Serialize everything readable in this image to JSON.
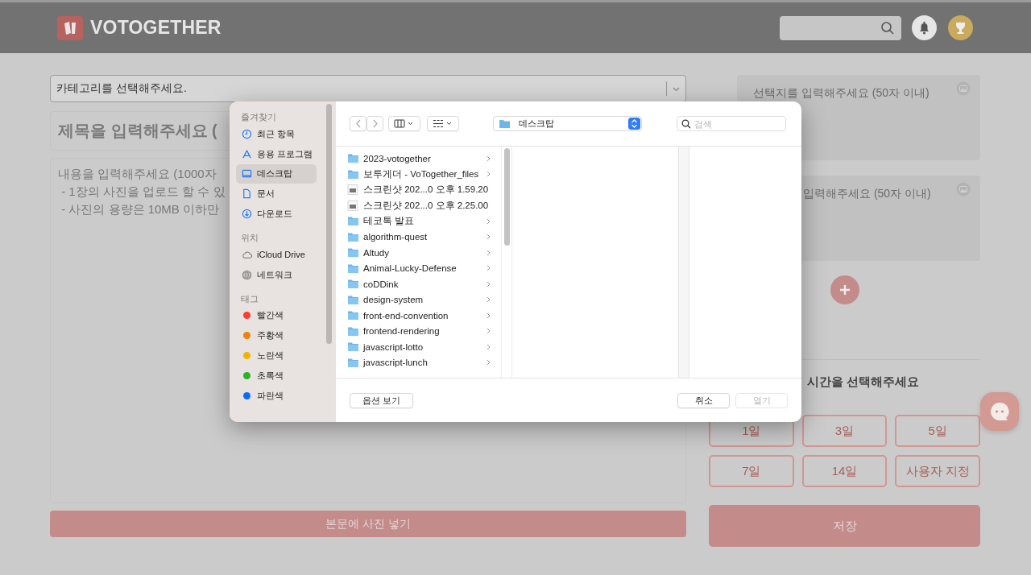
{
  "header": {
    "logo": "VOTOGETHER"
  },
  "editor": {
    "category": {
      "placeholder": "카테고리를 선택해주세요."
    },
    "title": {
      "placeholder": "제목을 입력해주세요 ("
    },
    "content": {
      "placeholder": "내용을 입력해주세요 (1000자\n - 1장의 사진을 업로드 할 수 있\n - 사진의 용량은 10MB 이하만"
    },
    "photo_button": "본문에 사진 넣기"
  },
  "options": [
    {
      "placeholder": "선택지를 입력해주세요 (50자 이내)"
    },
    {
      "placeholder": "입력해주세요 (50자 이내)"
    }
  ],
  "duration": {
    "heading": "시간을 선택해주세요",
    "options": [
      {
        "label": "1일",
        "selected": false
      },
      {
        "label": "3일",
        "selected": false
      },
      {
        "label": "5일",
        "selected": false
      },
      {
        "label": "7일",
        "selected": false
      },
      {
        "label": "14일",
        "selected": false
      },
      {
        "label": "사용자 지정",
        "selected": false
      }
    ]
  },
  "save_button": "저장",
  "file_dialog": {
    "sidebar": [
      {
        "heading": "즐겨찾기",
        "items": [
          {
            "label": "최근 항목",
            "kind": "clock",
            "selected": false
          },
          {
            "label": "응용 프로그램",
            "kind": "apps",
            "selected": false
          },
          {
            "label": "데스크탑",
            "kind": "desktop",
            "selected": true
          },
          {
            "label": "문서",
            "kind": "document",
            "selected": false
          },
          {
            "label": "다운로드",
            "kind": "download",
            "selected": false
          }
        ]
      },
      {
        "heading": "위치",
        "items": [
          {
            "label": "iCloud Drive",
            "kind": "cloud",
            "selected": false
          },
          {
            "label": "네트워크",
            "kind": "globe",
            "selected": false
          }
        ]
      },
      {
        "heading": "태그",
        "items": [
          {
            "label": "빨간색",
            "kind": "tag",
            "color": "#ff3b30",
            "selected": false
          },
          {
            "label": "주황색",
            "kind": "tag",
            "color": "#f0800a",
            "selected": false
          },
          {
            "label": "노란색",
            "kind": "tag",
            "color": "#f0b400",
            "selected": false
          },
          {
            "label": "초록색",
            "kind": "tag",
            "color": "#28b428",
            "selected": false
          },
          {
            "label": "파란색",
            "kind": "tag",
            "color": "#0a6cff",
            "selected": false
          }
        ]
      }
    ],
    "location": "데스크탑",
    "search": {
      "placeholder": "검색"
    },
    "files": [
      {
        "name": "2023-votogether",
        "kind": "folder"
      },
      {
        "name": "보투게더 - VoTogether_files",
        "kind": "folder"
      },
      {
        "name": "스크린샷 202...0 오후 1.59.20",
        "kind": "image"
      },
      {
        "name": "스크린샷 202...0 오후 2.25.00",
        "kind": "image"
      },
      {
        "name": "테코톡 발표",
        "kind": "folder"
      },
      {
        "name": "algorithm-quest",
        "kind": "folder"
      },
      {
        "name": "Altudy",
        "kind": "folder"
      },
      {
        "name": "Animal-Lucky-Defense",
        "kind": "folder"
      },
      {
        "name": "coDDink",
        "kind": "folder"
      },
      {
        "name": "design-system",
        "kind": "folder"
      },
      {
        "name": "front-end-convention",
        "kind": "folder"
      },
      {
        "name": "frontend-rendering",
        "kind": "folder"
      },
      {
        "name": "javascript-lotto",
        "kind": "folder"
      },
      {
        "name": "javascript-lunch",
        "kind": "folder"
      }
    ],
    "buttons": [
      {
        "label": "옵션 보기",
        "disabled": false
      },
      {
        "label": "취소",
        "disabled": false
      },
      {
        "label": "열기",
        "disabled": true
      }
    ]
  }
}
